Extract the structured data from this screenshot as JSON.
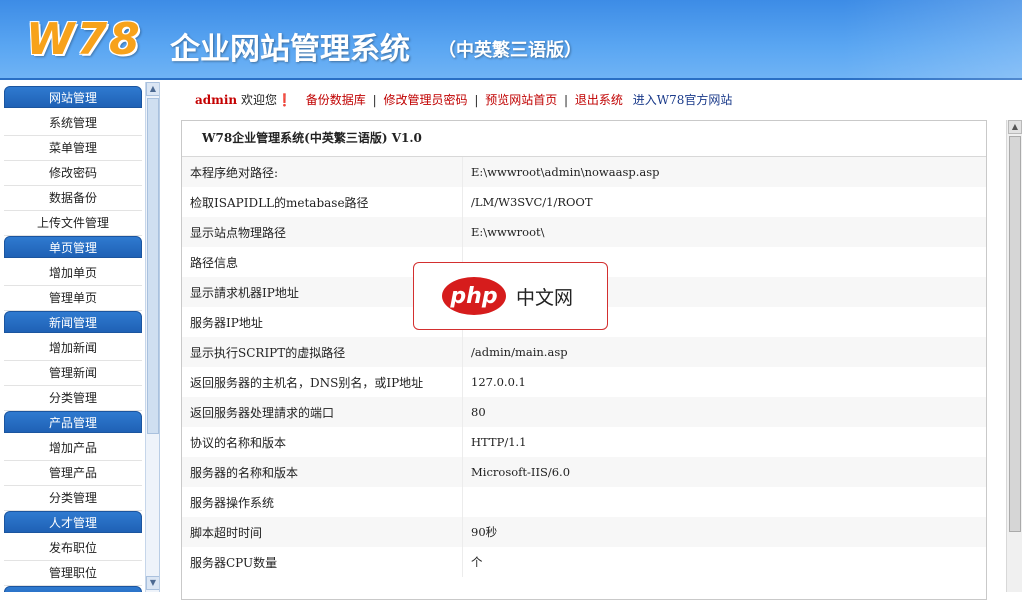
{
  "header": {
    "logo": "W78",
    "title": "企业网站管理系统",
    "subtitle": "（中英繁三语版）"
  },
  "sidebar": {
    "groups": [
      {
        "title": "网站管理",
        "items": [
          "系统管理",
          "菜单管理",
          "修改密码",
          "数据备份",
          "上传文件管理"
        ]
      },
      {
        "title": "单页管理",
        "items": [
          "增加单页",
          "管理单页"
        ]
      },
      {
        "title": "新闻管理",
        "items": [
          "增加新闻",
          "管理新闻",
          "分类管理"
        ]
      },
      {
        "title": "产品管理",
        "items": [
          "增加产品",
          "管理产品",
          "分类管理"
        ]
      },
      {
        "title": "人才管理",
        "items": [
          "发布职位",
          "管理职位"
        ]
      }
    ]
  },
  "toolbar": {
    "user": "admin",
    "welcome": "欢迎您❗",
    "links": [
      "备份数据库",
      "修改管理员密码",
      "预览网站首页",
      "退出系统"
    ],
    "official": "进入W78官方网站"
  },
  "panel": {
    "title": "W78企业管理系统(中英繁三语版) V1.0",
    "rows": [
      {
        "label": "本程序绝对路径:",
        "value": "E:\\wwwroot\\admin\\nowaasp.asp"
      },
      {
        "label": "检取ISAPIDLL的metabase路径",
        "value": "/LM/W3SVC/1/ROOT"
      },
      {
        "label": "显示站点物理路径",
        "value": "E:\\wwwroot\\"
      },
      {
        "label": "路径信息",
        "value": ""
      },
      {
        "label": "显示請求机器IP地址",
        "value": ""
      },
      {
        "label": "服务器IP地址",
        "value": ""
      },
      {
        "label": "显示执行SCRIPT的虚拟路径",
        "value": "/admin/main.asp"
      },
      {
        "label": "返回服务器的主机名，DNS别名，或IP地址",
        "value": "127.0.0.1"
      },
      {
        "label": "返回服务器处理請求的端口",
        "value": "80"
      },
      {
        "label": "协议的名称和版本",
        "value": "HTTP/1.1"
      },
      {
        "label": "服务器的名称和版本",
        "value": "Microsoft-IIS/6.0"
      },
      {
        "label": "服务器操作系统",
        "value": ""
      },
      {
        "label": "脚本超时时间",
        "value": "90秒"
      },
      {
        "label": "服务器CPU数量",
        "value": "个"
      }
    ]
  },
  "watermark": {
    "logo": "php",
    "text": "中文网"
  }
}
